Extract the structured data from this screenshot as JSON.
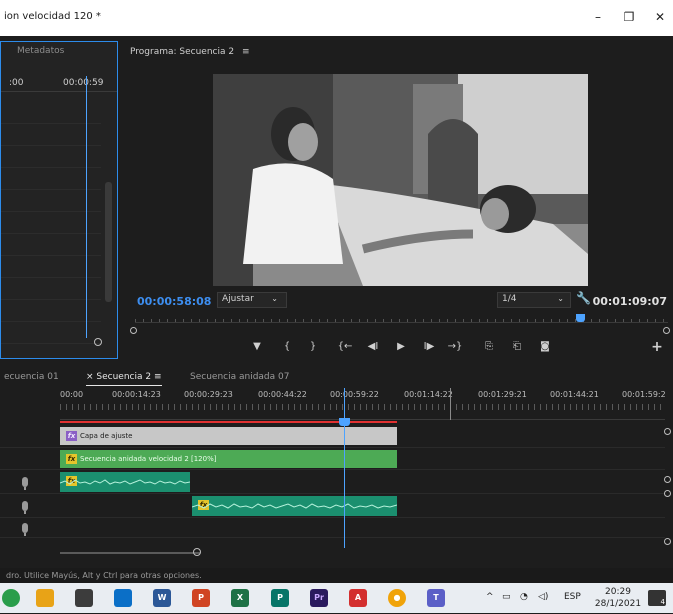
{
  "window": {
    "title": "ion velocidad 120 *",
    "minimize": "–",
    "maximize": "❐",
    "close": "✕"
  },
  "metadata_panel": {
    "tab": "Metadatos",
    "tc_left": ":00",
    "tc_right": "00:00:59"
  },
  "program": {
    "tab": "Programa: Secuencia 2",
    "tab_menu": "≡",
    "current_tc": "00:00:58:08",
    "fit": "Ajustar",
    "resolution": "1/4",
    "duration_tc": "00:01:09:07",
    "transport": [
      "▼",
      "{",
      "}",
      "{←",
      "◀I",
      "▶",
      "I▶",
      "→}",
      "⎘",
      "⎗",
      "◙",
      "+"
    ]
  },
  "timeline": {
    "tabs": [
      {
        "label": "ecuencia 01",
        "active": false
      },
      {
        "label": "× Secuencia 2 ≡",
        "active": true
      },
      {
        "label": "Secuencia anidada 07",
        "active": false
      }
    ],
    "ruler_ticks": [
      "00:00",
      "00:00:14:23",
      "00:00:29:23",
      "00:00:44:22",
      "00:00:59:22",
      "00:01:14:22",
      "00:01:29:21",
      "00:01:44:21",
      "00:01:59:2"
    ],
    "clips": {
      "adjustment": "Capa de ajuste",
      "nested": "Secuencia anidada velocidad 2 [120%]",
      "fx": "fx"
    }
  },
  "status_bar": "dro. Utilice Mayús, Alt y Ctrl para otras opciones.",
  "taskbar": {
    "apps": [
      {
        "name": "word-app",
        "label": "W",
        "color": "#2b5797"
      },
      {
        "name": "powerpoint-app",
        "label": "P",
        "color": "#d04423"
      },
      {
        "name": "excel-app",
        "label": "X",
        "color": "#1e7145"
      },
      {
        "name": "publisher-app",
        "label": "P",
        "color": "#077568"
      },
      {
        "name": "premiere-app",
        "label": "Pr",
        "color": "#2a1a5e"
      },
      {
        "name": "acrobat-app",
        "label": "A",
        "color": "#d32f2f"
      },
      {
        "name": "chrome-app",
        "label": "●",
        "color": "#f0a30a"
      },
      {
        "name": "teams-app",
        "label": "T",
        "color": "#5b5fc7"
      }
    ],
    "tray_arrow": "^",
    "language": "ESP",
    "time": "20:29",
    "date": "28/1/2021",
    "notifications": "4"
  }
}
